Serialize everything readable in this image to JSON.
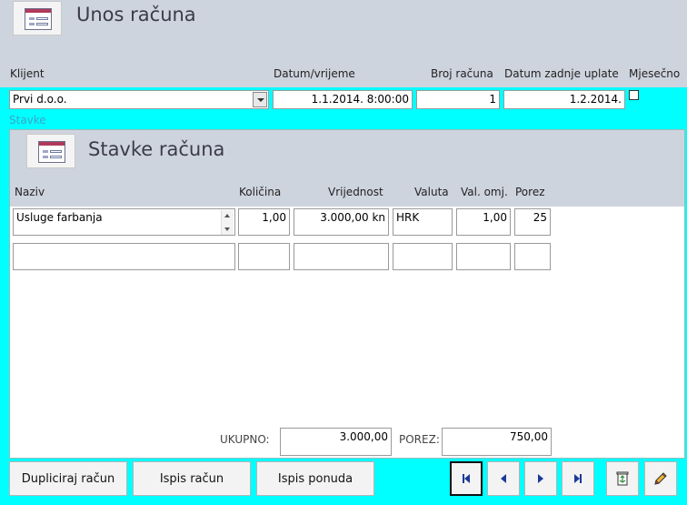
{
  "form": {
    "title": "Unos računa"
  },
  "labels": {
    "klijent": "Klijent",
    "datum": "Datum/vrijeme",
    "broj": "Broj računa",
    "datum_uplate": "Datum zadnje uplate",
    "mjesecno": "Mjesečno",
    "stavke": "Stavke"
  },
  "values": {
    "klijent": "Prvi d.o.o.",
    "datum": "1.1.2014. 8:00:00",
    "broj": "1",
    "datum_uplate": "1.2.2014."
  },
  "subform": {
    "title": "Stavke računa",
    "columns": {
      "naziv": "Naziv",
      "kolicina": "Količina",
      "vrijednost": "Vrijednost",
      "valuta": "Valuta",
      "valomj": "Val. omj.",
      "porez": "Porez"
    },
    "row1": {
      "naziv": "Usluge farbanja",
      "kolicina": "1,00",
      "vrijednost": "3.000,00 kn",
      "valuta": "HRK",
      "valomj": "1,00",
      "porez": "25"
    },
    "totals": {
      "ukupno_label": "UKUPNO:",
      "ukupno": "3.000,00",
      "porez_label": "POREZ:",
      "porez": "750,00"
    }
  },
  "buttons": {
    "dupliciraj": "Dupliciraj račun",
    "ispis": "Ispis račun",
    "ponuda": "Ispis ponuda"
  },
  "icons": {
    "form": "form-icon",
    "first": "first-record-icon",
    "prev": "previous-record-icon",
    "next": "next-record-icon",
    "last": "last-record-icon",
    "delete": "recycle-bin-icon",
    "edit": "pencil-icon"
  },
  "colors": {
    "background": "#00ffff",
    "header": "#ced4de",
    "nav_arrow": "#1a3a9a"
  }
}
